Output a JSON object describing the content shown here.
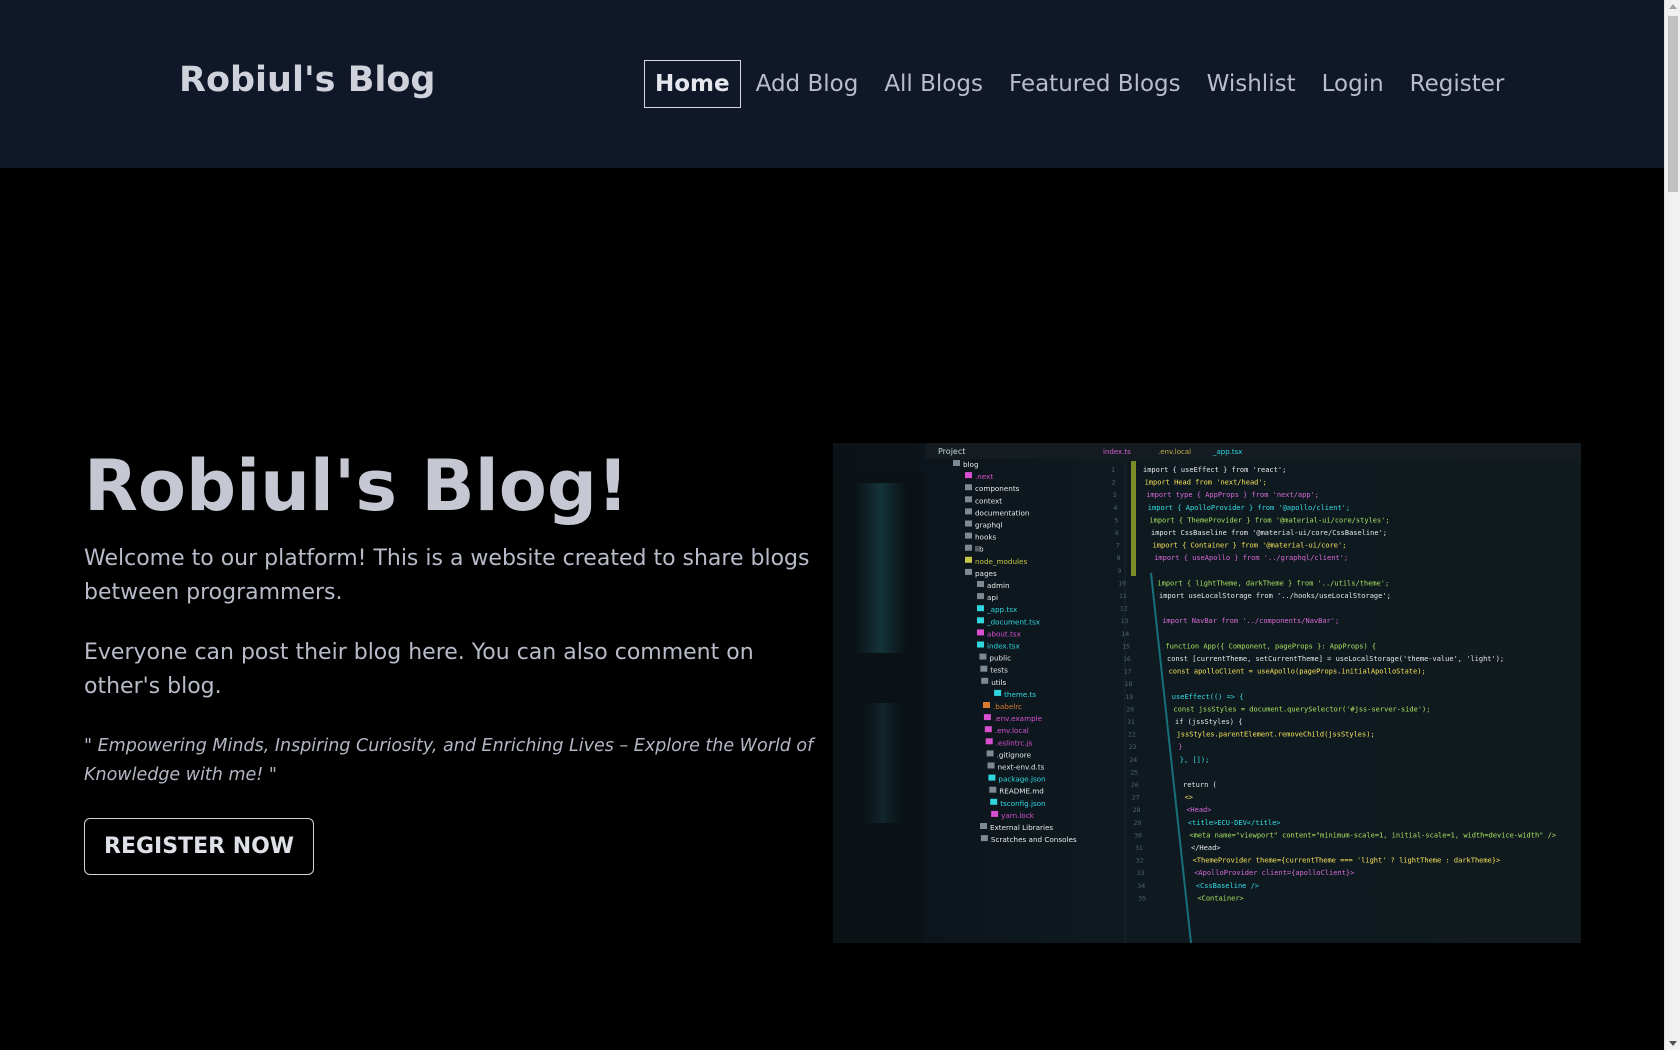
{
  "navbar": {
    "brand": "Robiul's Blog",
    "links": [
      {
        "label": "Home",
        "active": true
      },
      {
        "label": "Add Blog",
        "active": false
      },
      {
        "label": "All Blogs",
        "active": false
      },
      {
        "label": "Featured Blogs",
        "active": false
      },
      {
        "label": "Wishlist",
        "active": false
      },
      {
        "label": "Login",
        "active": false
      },
      {
        "label": "Register",
        "active": false
      }
    ]
  },
  "hero": {
    "title": "Robiul's Blog!",
    "paragraph1": "Welcome to our platform! This is a website created to share blogs between programmers.",
    "paragraph2": "Everyone can post their blog here. You can also comment on other's blog.",
    "quote": "\" Empowering Minds, Inspiring Curiosity, and Enriching Lives – Explore the World of Knowledge with me! \"",
    "cta_label": "REGISTER NOW"
  },
  "image": {
    "subject": "code editor screenshot",
    "project_label": "Project",
    "tabs": [
      "index.ts",
      ".env.local",
      "_app.tsx"
    ],
    "tree": [
      "blog",
      ".next",
      "components",
      "context",
      "documentation",
      "graphql",
      "hooks",
      "lib",
      "node_modules",
      "pages",
      "admin",
      "api",
      "_app.tsx",
      "_document.tsx",
      "about.tsx",
      "index.tsx",
      "public",
      "tests",
      "utils",
      "theme.ts",
      ".babelrc",
      ".env.example",
      ".env.local",
      ".eslintrc.js",
      ".gitignore",
      "next-env.d.ts",
      "package.json",
      "README.md",
      "tsconfig.json",
      "yarn.lock",
      "External Libraries",
      "Scratches and Consoles"
    ],
    "code": [
      "import { useEffect } from 'react';",
      "import Head from 'next/head';",
      "import type { AppProps } from 'next/app';",
      "import { ApolloProvider } from '@apollo/client';",
      "import { ThemeProvider } from '@material-ui/core/styles';",
      "import CssBaseline from '@material-ui/core/CssBaseline';",
      "import { Container } from '@material-ui/core';",
      "import { useApollo } from '../graphql/client';",
      "",
      "import { lightTheme, darkTheme } from '../utils/theme';",
      "import useLocalStorage from '../hooks/useLocalStorage';",
      "",
      "import NavBar from '../components/NavBar';",
      "",
      "function App({ Component, pageProps }: AppProps) {",
      "  const [currentTheme, setCurrentTheme] = useLocalStorage('theme-value', 'light');",
      "  const apolloClient = useApollo(pageProps.initialApolloState);",
      "",
      "  useEffect(() => {",
      "    const jssStyles = document.querySelector('#jss-server-side');",
      "    if (jssStyles) {",
      "      jssStyles.parentElement.removeChild(jssStyles);",
      "    }",
      "  }, []);",
      "",
      "  return (",
      "    <>",
      "      <Head>",
      "        <title>ECU-DEV</title>",
      "        <meta name=\"viewport\" content=\"minimum-scale=1, initial-scale=1, width=device-width\" />",
      "      </Head>",
      "      <ThemeProvider theme={currentTheme === 'light' ? lightTheme : darkTheme}>",
      "        <ApolloProvider client={apolloClient}>",
      "          <CssBaseline />",
      "          <Container>"
    ]
  },
  "colors": {
    "navbar_bg": "#0f1729",
    "page_bg": "#000000",
    "text": "#c8cad6"
  }
}
